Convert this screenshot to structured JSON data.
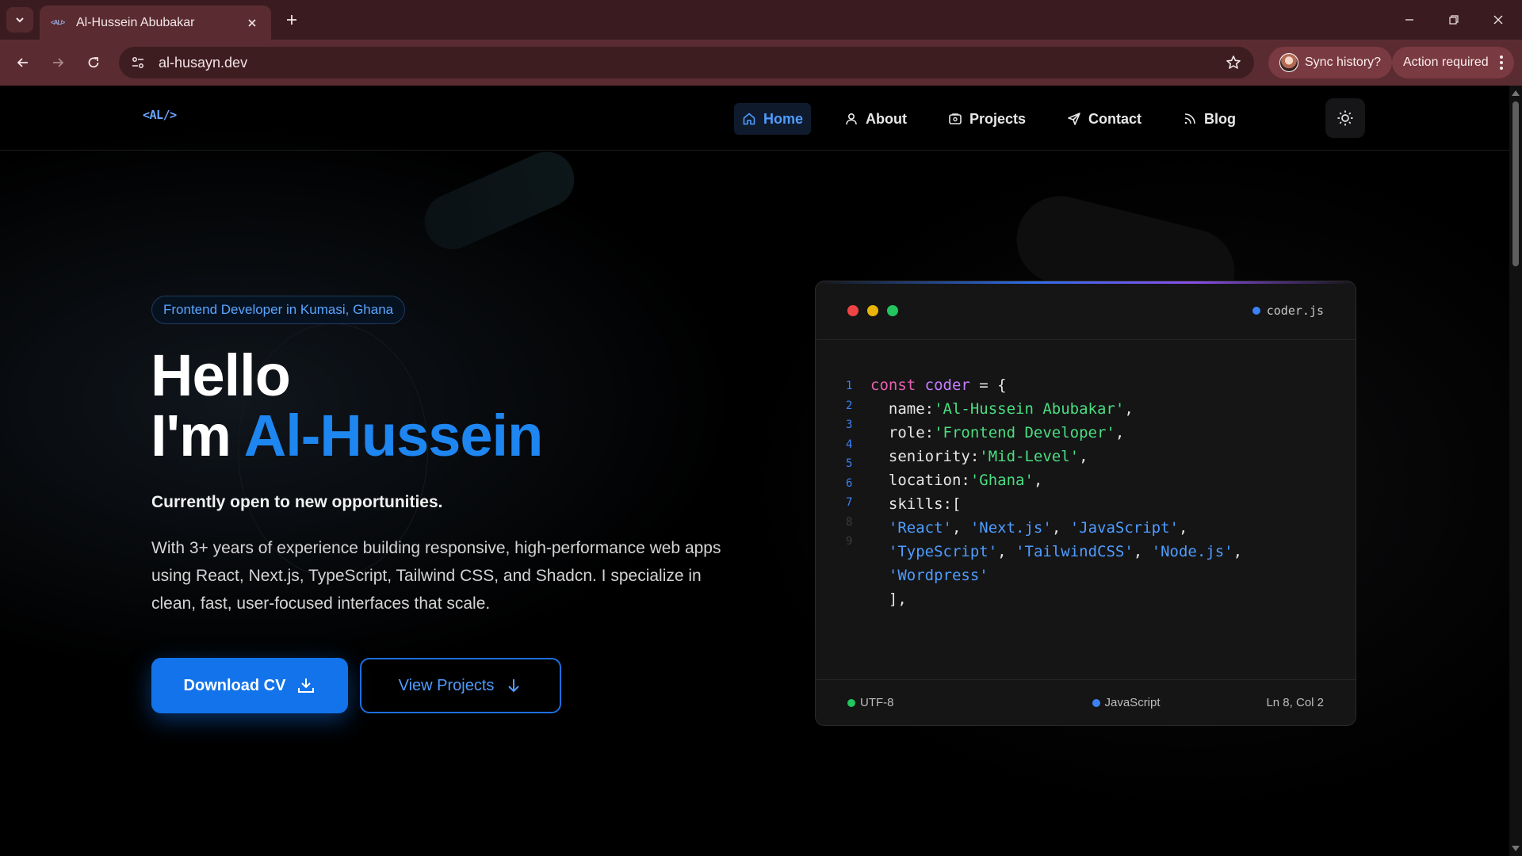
{
  "browser": {
    "tab_title": "Al-Hussein Abubakar",
    "favicon_text": "<AL/>",
    "url": "al-husayn.dev",
    "sync_label": "Sync history?",
    "action_label": "Action required"
  },
  "site": {
    "logo": "<AL/>",
    "nav": [
      {
        "label": "Home",
        "icon": "home-icon",
        "active": true
      },
      {
        "label": "About",
        "icon": "user-icon"
      },
      {
        "label": "Projects",
        "icon": "folder-icon"
      },
      {
        "label": "Contact",
        "icon": "send-icon"
      },
      {
        "label": "Blog",
        "icon": "rss-icon"
      }
    ],
    "theme_icon": "sun-icon"
  },
  "hero": {
    "badge": "Frontend Developer in Kumasi, Ghana",
    "title_line1": "Hello",
    "title_prefix": "I'm ",
    "title_name": "Al-Hussein",
    "subtitle": "Currently open to new opportunities.",
    "description": "With 3+ years of experience building responsive, high-performance web apps using React, Next.js, TypeScript, Tailwind CSS, and Shadcn. I specialize in clean, fast, user-focused interfaces that scale.",
    "primary_button": "Download CV",
    "secondary_button": "View Projects"
  },
  "code_card": {
    "filename": "coder.js",
    "line_numbers": [
      "1",
      "2",
      "3",
      "4",
      "5",
      "6",
      "7",
      "8",
      "9"
    ],
    "keyword": "const",
    "var_name": "coder",
    "operator": " = {",
    "name_key": "name:",
    "name_val": "'Al-Hussein Abubakar'",
    "role_key": "role:",
    "role_val": "'Frontend Developer'",
    "seniority_key": "seniority:",
    "seniority_val": "'Mid-Level'",
    "location_key": "location:",
    "location_val": "'Ghana'",
    "skills_key": "skills:[",
    "skills": [
      "'React'",
      "'Next.js'",
      "'JavaScript'",
      "'TypeScript'",
      "'TailwindCSS'",
      "'Node.js'",
      "'Wordpress'"
    ],
    "close_bracket": "],",
    "footer": {
      "encoding": "UTF-8",
      "language": "JavaScript",
      "position": "Ln 8, Col 2"
    }
  },
  "colors": {
    "accent": "#1e86f0",
    "primary_button": "#1273ea",
    "string": "#4ade80",
    "skill": "#4f9dff",
    "keyword": "#e75fb0"
  }
}
